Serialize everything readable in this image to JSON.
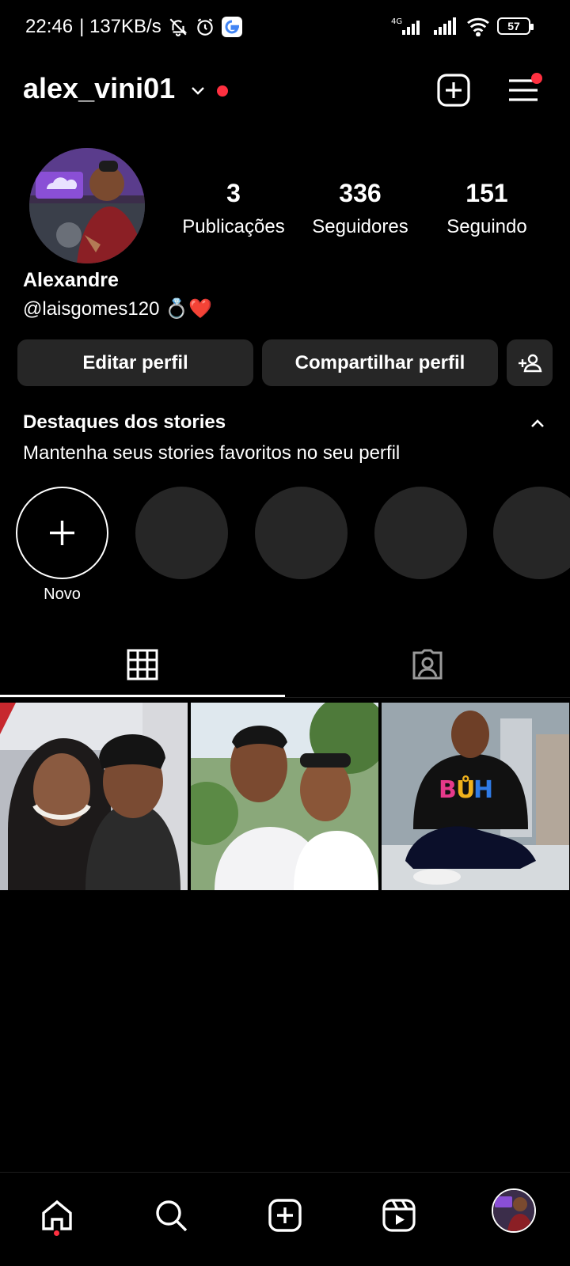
{
  "status_bar": {
    "time": "22:46",
    "speed": "| 137KB/s",
    "network_tag": "4G",
    "battery": "57",
    "icons": [
      "mute-icon",
      "alarm-icon",
      "google-icon",
      "signal-icon",
      "signal-icon",
      "wifi-icon",
      "battery-icon"
    ]
  },
  "header": {
    "username": "alex_vini01",
    "icons": [
      "chevron-down-icon",
      "new-post-icon",
      "menu-icon"
    ],
    "accent": "#ff3040"
  },
  "profile": {
    "stats": [
      {
        "num": "3",
        "label": "Publicações"
      },
      {
        "num": "336",
        "label": "Seguidores"
      },
      {
        "num": "151",
        "label": "Seguindo"
      }
    ],
    "name": "Alexandre",
    "bio": "@laisgomes120 💍❤️"
  },
  "actions": {
    "edit": "Editar perfil",
    "share": "Compartilhar perfil",
    "add_icon": "add-person-icon"
  },
  "highlights": {
    "title": "Destaques dos stories",
    "subtitle": "Mantenha seus stories favoritos no seu perfil",
    "new_label": "Novo",
    "placeholders": 4
  },
  "tabs": [
    "grid-icon",
    "tagged-icon"
  ],
  "grid": {
    "posts": [
      "photo-couple",
      "photo-two-friends",
      "photo-boy-balcony"
    ]
  },
  "bottom_nav": [
    "home-icon",
    "search-icon",
    "create-icon",
    "reels-icon",
    "profile-avatar"
  ],
  "colors": {
    "bg": "#000000",
    "surface": "#262626",
    "text": "#ffffff",
    "notification": "#ff3040"
  }
}
